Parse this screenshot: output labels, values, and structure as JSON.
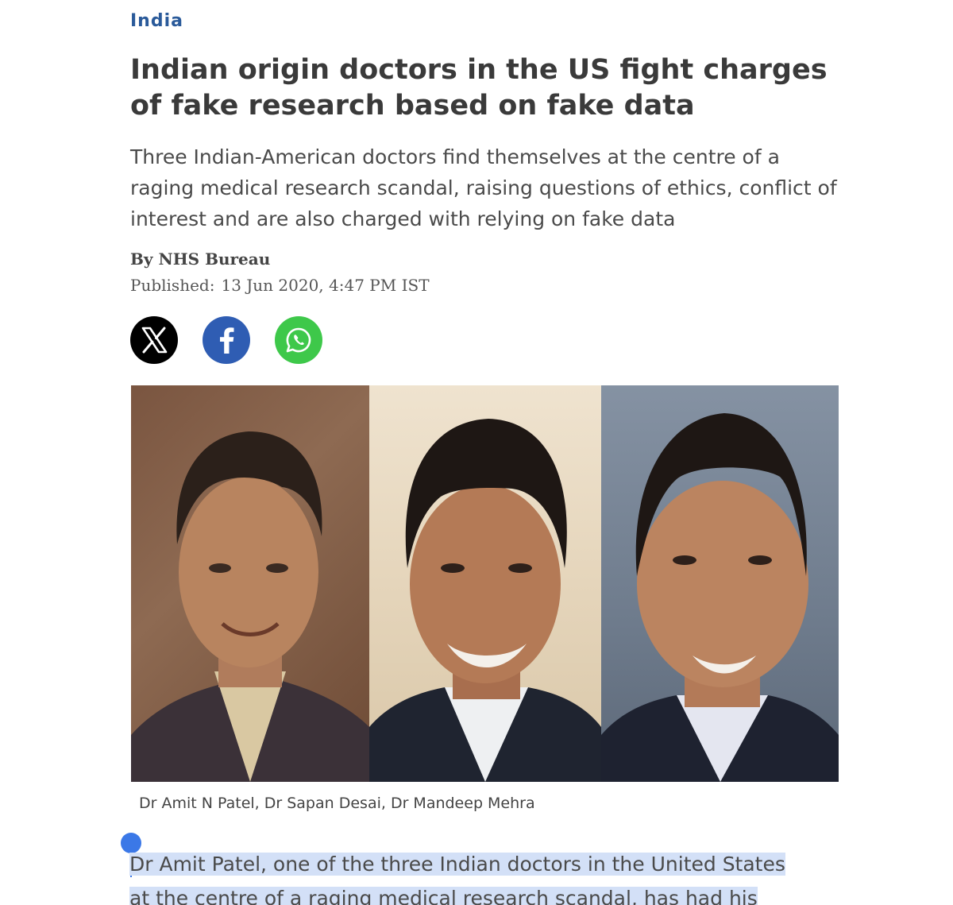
{
  "article": {
    "section": "India",
    "headline": "Indian origin doctors in the US fight charges of fake research based on fake data",
    "standfirst": "Three Indian-American doctors find themselves at the centre of a raging medical research scandal, raising questions of ethics, conflict of interest and are also charged with relying on fake data",
    "byline": "By NHS Bureau",
    "published_label": "Published:",
    "published_date": "13 Jun 2020, 4:47 PM IST",
    "share": [
      {
        "name": "x-share-button",
        "icon": "x-logo-icon",
        "color": "#000000"
      },
      {
        "name": "facebook-share-button",
        "icon": "facebook-logo-icon",
        "color": "#2f5db3"
      },
      {
        "name": "whatsapp-share-button",
        "icon": "whatsapp-logo-icon",
        "color": "#3ec84a"
      }
    ],
    "photo_caption": "Dr Amit N Patel, Dr Sapan Desai, Dr Mandeep Mehra",
    "body_line_1": "Dr Amit Patel, one of the three Indian doctors in the United States",
    "body_line_2": "at the centre of a raging medical research scandal, has had his"
  },
  "colors": {
    "section_tag": "#2a5a9a",
    "selection_highlight": "#d3e0f7",
    "selection_handle": "#3b78e7"
  }
}
